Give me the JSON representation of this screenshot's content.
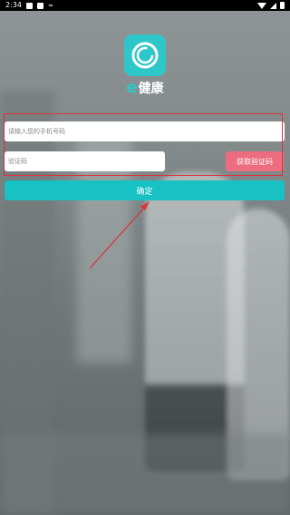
{
  "status_bar": {
    "time": "2:34"
  },
  "brand": {
    "letter": "e",
    "name": "健康"
  },
  "form": {
    "phone_placeholder": "请输入您的手机号码",
    "code_placeholder": "验证码",
    "get_code_label": "获取验证码",
    "confirm_label": "确定"
  },
  "colors": {
    "accent": "#17c1c4",
    "get_code_button": "#ec6d80",
    "annotation": "#e0303a"
  },
  "icons": [
    "app-logo-icon",
    "notification-icon",
    "wifi-icon",
    "signal-icon",
    "battery-icon"
  ]
}
